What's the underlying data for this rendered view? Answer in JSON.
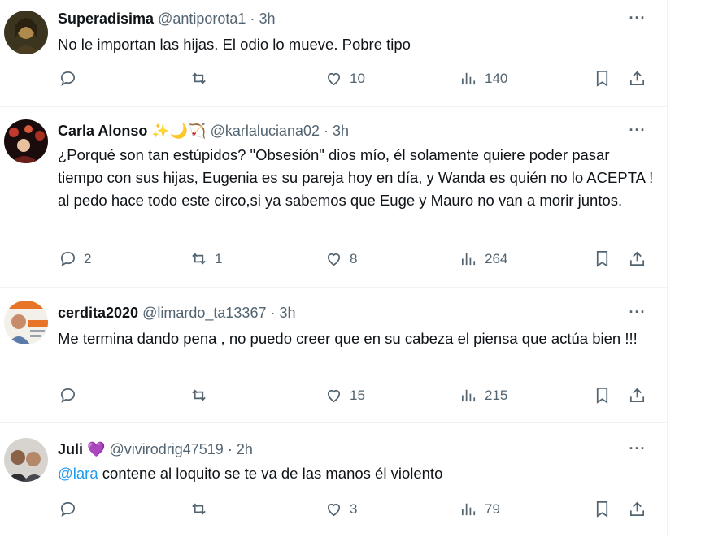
{
  "tweets": [
    {
      "name": "Superadisima",
      "emoji": "",
      "handle": "@antiporota1",
      "sep": "·",
      "time": "3h",
      "text": "No le importan las hijas. El odio lo mueve. Pobre tipo",
      "replies": "",
      "retweets": "",
      "likes": "10",
      "views": "140"
    },
    {
      "name": "Carla Alonso",
      "emoji": "✨🌙🏹",
      "handle": "@karlaluciana02",
      "sep": "·",
      "time": "3h",
      "text": "¿Porqué son tan estúpidos? \"Obsesión\" dios mío, él solamente quiere poder pasar tiempo con sus hijas, Eugenia es su pareja hoy en día, y Wanda es quién no lo ACEPTA ! al pedo hace todo este circo,si ya sabemos que Euge y Mauro no van a morir juntos.",
      "replies": "2",
      "retweets": "1",
      "likes": "8",
      "views": "264"
    },
    {
      "name": "cerdita2020",
      "emoji": "",
      "handle": "@limardo_ta13367",
      "sep": "·",
      "time": "3h",
      "text": "Me termina dando pena , no puedo creer que en su cabeza el piensa que actúa bien !!!",
      "replies": "",
      "retweets": "",
      "likes": "15",
      "views": "215"
    },
    {
      "name": "Juli",
      "emoji": "💜",
      "handle": "@vivirodrig47519",
      "sep": "·",
      "time": "2h",
      "mention": "@lara",
      "text": " contene al loquito se te va de las manos él violento",
      "replies": "",
      "retweets": "",
      "likes": "3",
      "views": "79"
    }
  ],
  "icons": {
    "more": "more-horizontal-icon",
    "reply": "reply-icon",
    "retweet": "retweet-icon",
    "like": "heart-icon",
    "views": "views-chart-icon",
    "bookmark": "bookmark-icon",
    "share": "share-icon"
  },
  "colors": {
    "text": "#0f1419",
    "secondary": "#536471",
    "link": "#1d9bf0",
    "divider": "#eff3f4"
  }
}
